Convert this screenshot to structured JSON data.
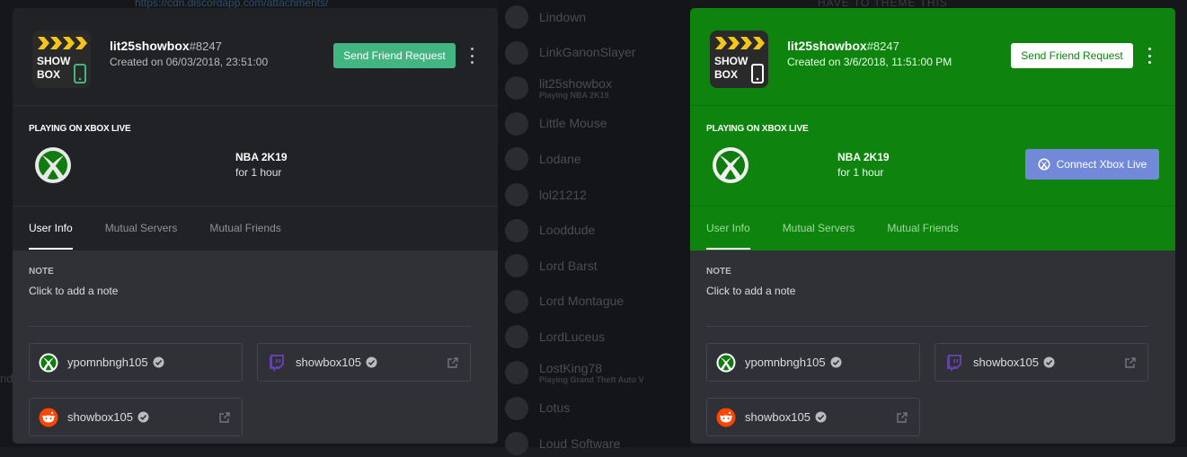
{
  "background": {
    "top_text_left": "https://cdn.discordapp.com/attachments/",
    "top_text_right": "HAVE TO THEME THIS",
    "left_fragment": "nd",
    "members": [
      {
        "name": "Lindown",
        "activity": ""
      },
      {
        "name": "LinkGanonSlayer",
        "activity": ""
      },
      {
        "name": "lit25showbox",
        "activity": "Playing NBA 2K19"
      },
      {
        "name": "Little Mouse",
        "activity": ""
      },
      {
        "name": "Lodane",
        "activity": ""
      },
      {
        "name": "lol21212",
        "activity": ""
      },
      {
        "name": "Looddude",
        "activity": ""
      },
      {
        "name": "Lord Barst",
        "activity": ""
      },
      {
        "name": "Lord Montague",
        "activity": ""
      },
      {
        "name": "LordLuceus",
        "activity": ""
      },
      {
        "name": "LostKing78",
        "activity": "Playing Grand Theft Auto V"
      },
      {
        "name": "Lotus",
        "activity": ""
      },
      {
        "name": "Loud Software",
        "activity": ""
      }
    ]
  },
  "cards": [
    {
      "username": "lit25showbox",
      "discriminator": "#8247",
      "created": "Created on 06/03/2018, 23:51:00",
      "friend_button": "Send Friend Request",
      "activity_header": "PLAYING ON XBOX LIVE",
      "game": "NBA 2K19",
      "duration": "for 1 hour",
      "connect_button": "",
      "tabs": [
        "User Info",
        "Mutual Servers",
        "Mutual Friends"
      ],
      "note_label": "NOTE",
      "note_placeholder": "Click to add a note",
      "accounts": [
        {
          "service": "xbox",
          "name": "ypomnbngh105"
        },
        {
          "service": "twitch",
          "name": "showbox105"
        },
        {
          "service": "reddit",
          "name": "showbox105"
        }
      ]
    },
    {
      "username": "lit25showbox",
      "discriminator": "#8247",
      "created": "Created on 3/6/2018, 11:51:00 PM",
      "friend_button": "Send Friend Request",
      "activity_header": "PLAYING ON XBOX LIVE",
      "game": "NBA 2K19",
      "duration": "for 1 hour",
      "connect_button": "Connect Xbox Live",
      "tabs": [
        "User Info",
        "Mutual Servers",
        "Mutual Friends"
      ],
      "note_label": "NOTE",
      "note_placeholder": "Click to add a note",
      "accounts": [
        {
          "service": "xbox",
          "name": "ypomnbngh105"
        },
        {
          "service": "twitch",
          "name": "showbox105"
        },
        {
          "service": "reddit",
          "name": "showbox105"
        }
      ]
    }
  ],
  "logo_text": [
    "SHOW",
    "BOX"
  ],
  "colors": {
    "xbox_green": "#0e840e",
    "friend_green": "#43b581",
    "blurple": "#7289da",
    "twitch_purple": "#6441a4",
    "reddit_orange": "#ff4500"
  }
}
